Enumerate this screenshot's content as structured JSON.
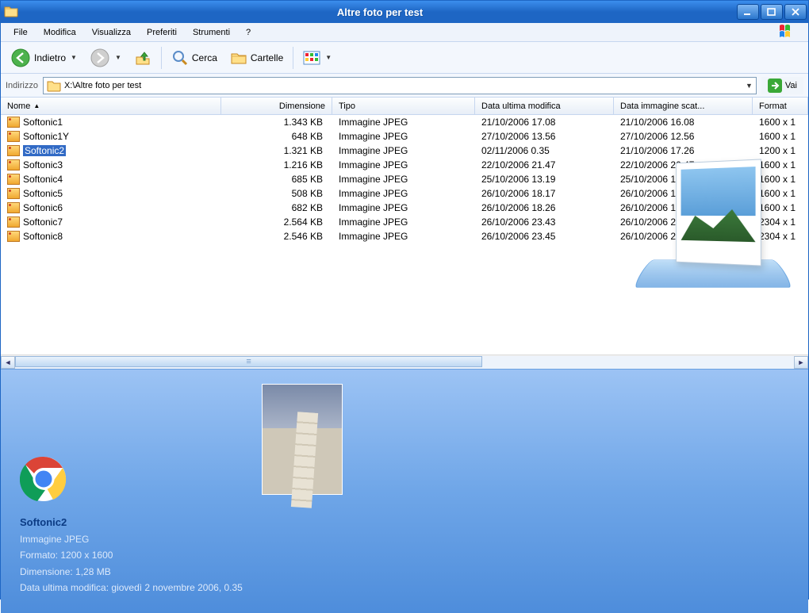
{
  "window": {
    "title": "Altre foto per test"
  },
  "menu": {
    "file": "File",
    "modifica": "Modifica",
    "visualizza": "Visualizza",
    "preferiti": "Preferiti",
    "strumenti": "Strumenti",
    "help": "?"
  },
  "toolbar": {
    "back": "Indietro",
    "search": "Cerca",
    "folders": "Cartelle"
  },
  "address": {
    "label": "Indirizzo",
    "path": "X:\\Altre foto per test",
    "go": "Vai"
  },
  "columns": {
    "name": "Nome",
    "dim": "Dimensione",
    "tipo": "Tipo",
    "data1": "Data ultima modifica",
    "data2": "Data immagine scat...",
    "form": "Format"
  },
  "files": [
    {
      "name": "Softonic1",
      "dim": "1.343 KB",
      "tipo": "Immagine JPEG",
      "d1": "21/10/2006 17.08",
      "d2": "21/10/2006 16.08",
      "form": "1600 x 1",
      "selected": false
    },
    {
      "name": "Softonic1Y",
      "dim": "648 KB",
      "tipo": "Immagine JPEG",
      "d1": "27/10/2006 13.56",
      "d2": "27/10/2006 12.56",
      "form": "1600 x 1",
      "selected": false
    },
    {
      "name": "Softonic2",
      "dim": "1.321 KB",
      "tipo": "Immagine JPEG",
      "d1": "02/11/2006 0.35",
      "d2": "21/10/2006 17.26",
      "form": "1200 x 1",
      "selected": true
    },
    {
      "name": "Softonic3",
      "dim": "1.216 KB",
      "tipo": "Immagine JPEG",
      "d1": "22/10/2006 21.47",
      "d2": "22/10/2006 20.47",
      "form": "1600 x 1",
      "selected": false
    },
    {
      "name": "Softonic4",
      "dim": "685 KB",
      "tipo": "Immagine JPEG",
      "d1": "25/10/2006 13.19",
      "d2": "25/10/2006 12.19",
      "form": "1600 x 1",
      "selected": false
    },
    {
      "name": "Softonic5",
      "dim": "508 KB",
      "tipo": "Immagine JPEG",
      "d1": "26/10/2006 18.17",
      "d2": "26/10/2006 17.17",
      "form": "1600 x 1",
      "selected": false
    },
    {
      "name": "Softonic6",
      "dim": "682 KB",
      "tipo": "Immagine JPEG",
      "d1": "26/10/2006 18.26",
      "d2": "26/10/2006 17.26",
      "form": "1600 x 1",
      "selected": false
    },
    {
      "name": "Softonic7",
      "dim": "2.564 KB",
      "tipo": "Immagine JPEG",
      "d1": "26/10/2006 23.43",
      "d2": "26/10/2006 22.43",
      "form": "2304 x 1",
      "selected": false
    },
    {
      "name": "Softonic8",
      "dim": "2.546 KB",
      "tipo": "Immagine JPEG",
      "d1": "26/10/2006 23.45",
      "d2": "26/10/2006 22.45",
      "form": "2304 x 1",
      "selected": false
    }
  ],
  "details": {
    "name": "Softonic2",
    "type": "Immagine JPEG",
    "formato_label": "Formato:",
    "formato": "1200 x 1600",
    "dim_label": "Dimensione:",
    "dim": "1,28 MB",
    "mod_label": "Data ultima modifica:",
    "mod": "giovedì 2 novembre 2006, 0.35"
  }
}
